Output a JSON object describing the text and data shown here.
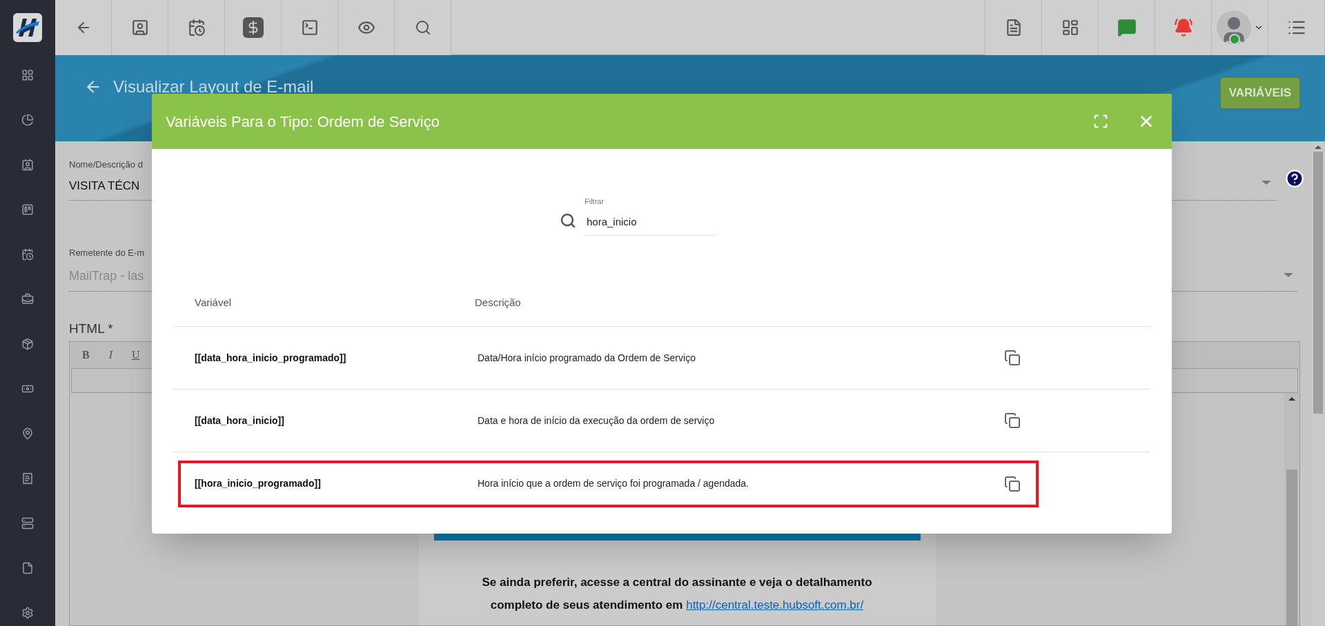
{
  "page": {
    "title": "Visualizar Layout de E-mail",
    "action_button": "VARIÁVEIS"
  },
  "form": {
    "name_label": "Nome/Descrição d",
    "name_value": "VISITA TÉCN",
    "sender_label": "Remetente do E-m",
    "sender_value": "MailTrap - las",
    "html_label": "HTML *",
    "editor_tools": [
      "B",
      "I",
      "U"
    ],
    "preview": {
      "line_1": "Se ainda preferir, acesse a central do assinante e veja o detalhamento",
      "line_2": "completo de seus atendimento em",
      "link": "http://central.teste.hubsoft.com.br/"
    }
  },
  "modal": {
    "title": "Variáveis Para o Tipo: Ordem de Serviço",
    "filter": {
      "label": "Filtrar",
      "value": "hora_inicio"
    },
    "columns": [
      "Variável",
      "Descrição"
    ],
    "rows": [
      {
        "variable": "[[data_hora_inicio_programado]]",
        "description": "Data/Hora início programado da Ordem de Serviço",
        "highlighted": false
      },
      {
        "variable": "[[data_hora_inicio]]",
        "description": "Data e hora de início da execução da ordem de serviço",
        "highlighted": false
      },
      {
        "variable": "[[hora_inicio_programado]]",
        "description": "Hora início que a ordem de serviço foi programada / agendada.",
        "highlighted": true
      }
    ]
  }
}
